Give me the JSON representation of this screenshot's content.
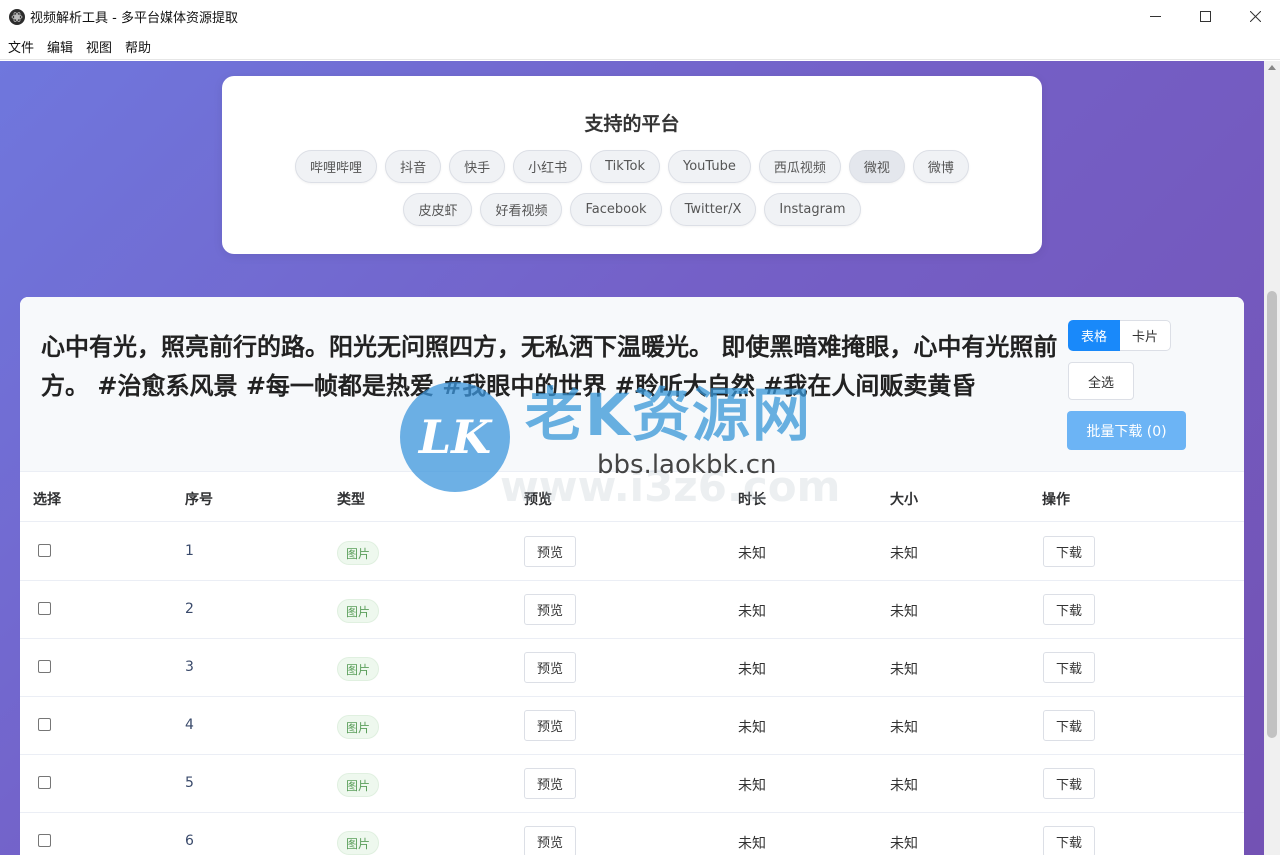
{
  "window": {
    "title": "视频解析工具 - 多平台媒体资源提取"
  },
  "menu": [
    "文件",
    "编辑",
    "视图",
    "帮助"
  ],
  "platforms": {
    "title": "支持的平台",
    "items": [
      "哔哩哔哩",
      "抖音",
      "快手",
      "小红书",
      "TikTok",
      "YouTube",
      "西瓜视频",
      "微视",
      "微博",
      "皮皮虾",
      "好看视频",
      "Facebook",
      "Twitter/X",
      "Instagram"
    ],
    "active": "微视"
  },
  "result": {
    "description": "心中有光，照亮前行的路。阳光无问照四方，无私洒下温暖光。 即使黑暗难掩眼，心中有光照前方。 #治愈系风景 #每一帧都是热爱 #我眼中的世界 #聆听大自然 #我在人间贩卖黄昏",
    "view_table": "表格",
    "view_card": "卡片",
    "select_all": "全选",
    "batch_download": "批量下载 (0)"
  },
  "table": {
    "headers": {
      "select": "选择",
      "index": "序号",
      "type": "类型",
      "preview": "预览",
      "duration": "时长",
      "size": "大小",
      "action": "操作"
    },
    "rows": [
      {
        "index": "1",
        "type": "图片",
        "preview": "预览",
        "duration": "未知",
        "size": "未知",
        "action": "下载"
      },
      {
        "index": "2",
        "type": "图片",
        "preview": "预览",
        "duration": "未知",
        "size": "未知",
        "action": "下载"
      },
      {
        "index": "3",
        "type": "图片",
        "preview": "预览",
        "duration": "未知",
        "size": "未知",
        "action": "下载"
      },
      {
        "index": "4",
        "type": "图片",
        "preview": "预览",
        "duration": "未知",
        "size": "未知",
        "action": "下载"
      },
      {
        "index": "5",
        "type": "图片",
        "preview": "预览",
        "duration": "未知",
        "size": "未知",
        "action": "下载"
      },
      {
        "index": "6",
        "type": "图片",
        "preview": "预览",
        "duration": "未知",
        "size": "未知",
        "action": "下载"
      }
    ]
  },
  "watermark": {
    "logo": "LK",
    "name": "老K资源网",
    "url": "bbs.laokbk.cn",
    "ghost": "www.i3z6.com"
  },
  "colors": {
    "accent": "#1989fa",
    "batch_button": "#6cb4f5",
    "tag_green": "#5a9e5a"
  }
}
